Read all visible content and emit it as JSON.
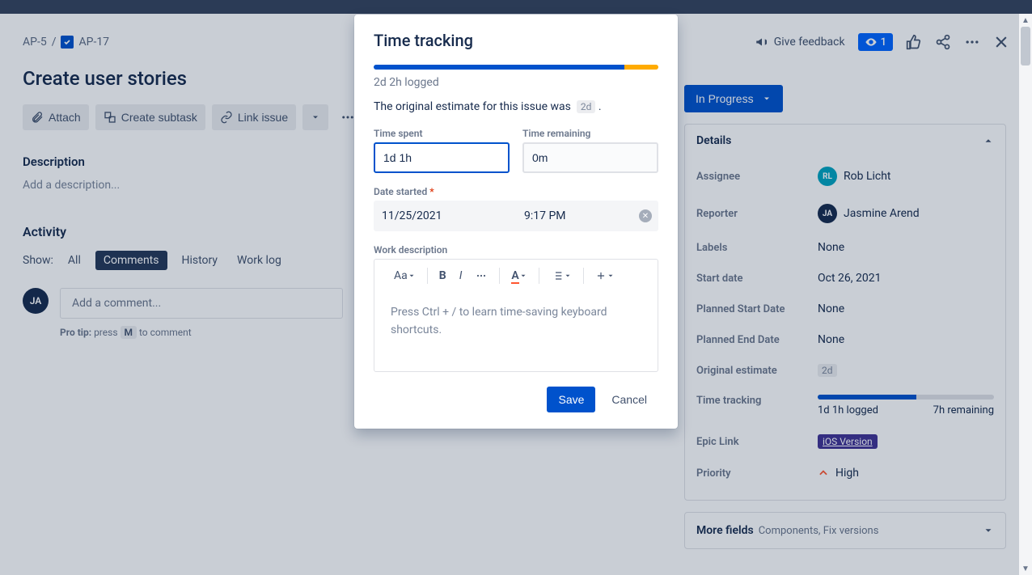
{
  "breadcrumbs": {
    "parent": "AP-5",
    "current": "AP-17"
  },
  "header_actions": {
    "feedback": "Give feedback",
    "watch_count": "1"
  },
  "page_title": "Create user stories",
  "buttons": {
    "attach": "Attach",
    "create_subtask": "Create subtask",
    "link_issue": "Link issue"
  },
  "description": {
    "heading": "Description",
    "placeholder": "Add a description..."
  },
  "activity": {
    "heading": "Activity",
    "show_label": "Show:",
    "tabs": {
      "all": "All",
      "comments": "Comments",
      "history": "History",
      "worklog": "Work log"
    },
    "comment_placeholder": "Add a comment...",
    "protip_prefix": "Pro tip:",
    "protip_press": "press",
    "protip_key": "M",
    "protip_suffix": "to comment",
    "avatar_initials": "JA"
  },
  "status_dropdown": "In Progress",
  "details": {
    "heading": "Details",
    "fields": {
      "assignee_label": "Assignee",
      "assignee_value": "Rob Licht",
      "assignee_initials": "RL",
      "reporter_label": "Reporter",
      "reporter_value": "Jasmine Arend",
      "reporter_initials": "JA",
      "labels_label": "Labels",
      "labels_value": "None",
      "startdate_label": "Start date",
      "startdate_value": "Oct 26, 2021",
      "planned_start_label": "Planned Start Date",
      "planned_start_value": "None",
      "planned_end_label": "Planned End Date",
      "planned_end_value": "None",
      "orig_est_label": "Original estimate",
      "orig_est_value": "2d",
      "timetracking_label": "Time tracking",
      "tt_logged": "1d 1h logged",
      "tt_remaining": "7h remaining",
      "epic_label": "Epic Link",
      "epic_value": "iOS Version",
      "priority_label": "Priority",
      "priority_value": "High"
    }
  },
  "more_fields": {
    "main": "More fields",
    "sub": "Components, Fix versions"
  },
  "modal": {
    "title": "Time tracking",
    "logged_summary": "2d 2h logged",
    "estimate_prefix": "The original estimate for this issue was",
    "estimate_tag": "2d",
    "time_spent_label": "Time spent",
    "time_spent_value": "1d 1h",
    "time_remaining_label": "Time remaining",
    "time_remaining_value": "0m",
    "date_started_label": "Date started",
    "date_value": "11/25/2021",
    "time_value": "9:17 PM",
    "work_desc_label": "Work description",
    "editor_placeholder": "Press Ctrl + / to learn time-saving keyboard shortcuts.",
    "toolbar": {
      "textstyle": "Aa"
    },
    "save": "Save",
    "cancel": "Cancel"
  }
}
